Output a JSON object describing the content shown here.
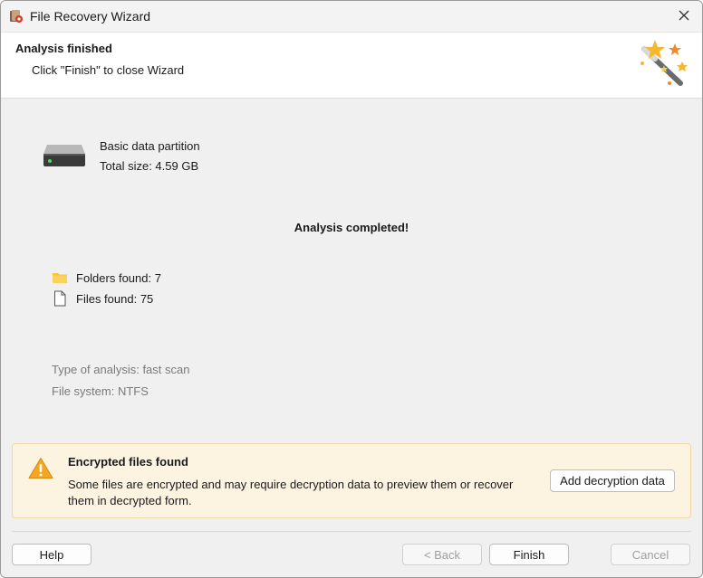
{
  "window": {
    "title": "File Recovery Wizard"
  },
  "header": {
    "title": "Analysis finished",
    "subtitle": "Click \"Finish\" to close Wizard"
  },
  "partition": {
    "name": "Basic data partition",
    "size_text": "Total size: 4.59 GB"
  },
  "status": "Analysis completed!",
  "stats": {
    "folders": "Folders found: 7",
    "files": "Files found: 75"
  },
  "meta": {
    "analysis_type": "Type of analysis: fast scan",
    "file_system": "File system: NTFS"
  },
  "banner": {
    "title": "Encrypted files found",
    "message": "Some files are encrypted and may require decryption data to preview them or recover them in decrypted form.",
    "button": "Add decryption data"
  },
  "footer": {
    "help": "Help",
    "back": "< Back",
    "finish": "Finish",
    "cancel": "Cancel"
  },
  "colors": {
    "banner_bg": "#fdf3e1",
    "warning": "#f5a623",
    "folder": "#f8c53a"
  }
}
